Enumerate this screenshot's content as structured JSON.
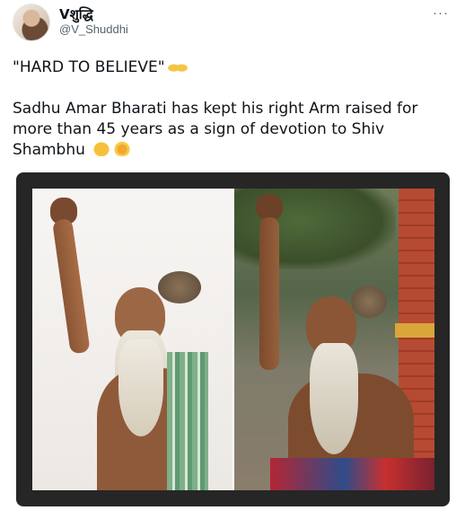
{
  "tweet": {
    "display_name": "Vशुद्धि",
    "handle": "@V_Shuddhi",
    "more_glyph": "···",
    "headline": "\"HARD TO BELIEVE\"",
    "body": "Sadhu Amar Bharati has kept his right Arm raised for more than 45 years as a sign of devotion to Shiv Shambhu"
  },
  "icons": {
    "avatar": "avatar-image",
    "more": "more-options-icon",
    "headline_emoji": "raising-hands-emoji",
    "body_emoji_1": "folded-hands-emoji",
    "body_emoji_2": "om-symbol-emoji"
  },
  "media": {
    "photos": [
      "photo-sadhu-raised-arm-studio",
      "photo-sadhu-raised-arm-outdoor"
    ],
    "frame_color": "#262626"
  }
}
